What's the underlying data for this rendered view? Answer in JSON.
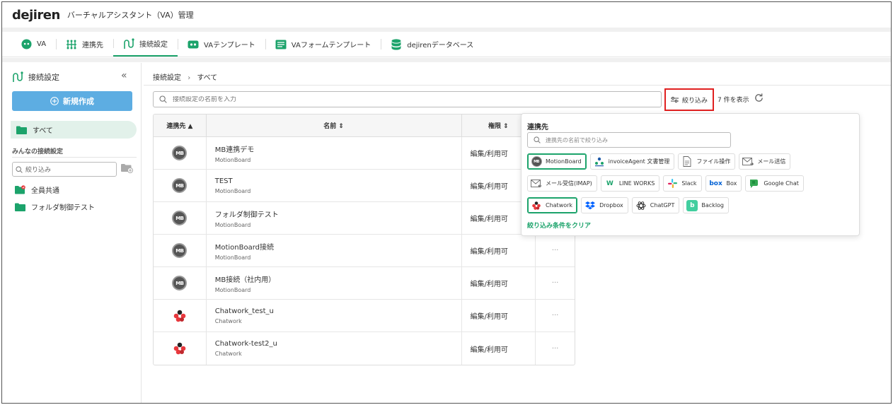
{
  "header": {
    "logo": "dejiren",
    "title": "バーチャルアシスタント（VA）管理"
  },
  "tabs": [
    {
      "label": "VA",
      "icon": "va-robot-icon"
    },
    {
      "label": "連携先",
      "icon": "network-icon"
    },
    {
      "label": "接続設定",
      "icon": "connection-icon"
    },
    {
      "label": "VAテンプレート",
      "icon": "template-icon"
    },
    {
      "label": "VAフォームテンプレート",
      "icon": "form-icon"
    },
    {
      "label": "dejirenデータベース",
      "icon": "database-icon"
    }
  ],
  "sidebar": {
    "heading": "接続設定",
    "collapse": "«",
    "new_button": "新規作成",
    "all_label": "すべて",
    "section_title": "みんなの接続設定",
    "filter_placeholder": "絞り込み",
    "items": [
      {
        "label": "全員共通"
      },
      {
        "label": "フォルダ制御テスト"
      }
    ]
  },
  "main": {
    "breadcrumb": [
      "接続設定",
      "›",
      "すべて"
    ],
    "search_placeholder": "接続設定の名前を入力",
    "filter_button": "絞り込み",
    "count_text": "7 件を表示",
    "table": {
      "headers": [
        "連携先 ▲",
        "名前 ⇕",
        "権限 ⇕"
      ],
      "rows": [
        {
          "service": "MotionBoard",
          "name": "MB連携デモ",
          "sub": "MotionBoard",
          "perm": "編集/利用可",
          "more": "···"
        },
        {
          "service": "MotionBoard",
          "name": "TEST",
          "sub": "MotionBoard",
          "perm": "編集/利用可",
          "more": "···"
        },
        {
          "service": "MotionBoard",
          "name": "フォルダ制御テスト",
          "sub": "MotionBoard",
          "perm": "編集/利用可",
          "more": "···"
        },
        {
          "service": "MotionBoard",
          "name": "MotionBoard接続",
          "sub": "MotionBoard",
          "perm": "編集/利用可",
          "more": "···"
        },
        {
          "service": "MotionBoard",
          "name": "MB接続（社内用）",
          "sub": "MotionBoard",
          "perm": "編集/利用可",
          "more": "···"
        },
        {
          "service": "Chatwork",
          "name": "Chatwork_test_u",
          "sub": "Chatwork",
          "perm": "編集/利用可",
          "more": "···"
        },
        {
          "service": "Chatwork",
          "name": "Chatwork-test2_u",
          "sub": "Chatwork",
          "perm": "編集/利用可",
          "more": "···"
        }
      ]
    }
  },
  "filter_panel": {
    "title": "連携先",
    "search_placeholder": "連携先の名前で絞り込み",
    "chips": [
      {
        "label": "MotionBoard",
        "selected": true
      },
      {
        "label": "invoiceAgent 文書管理",
        "selected": false
      },
      {
        "label": "ファイル操作",
        "selected": false
      },
      {
        "label": "メール送信",
        "selected": false
      },
      {
        "label": "メール受信(IMAP)",
        "selected": false
      },
      {
        "label": "LINE WORKS",
        "selected": false
      },
      {
        "label": "Slack",
        "selected": false
      },
      {
        "label": "Box",
        "selected": false
      },
      {
        "label": "Google Chat",
        "selected": false
      },
      {
        "label": "Chatwork",
        "selected": true
      },
      {
        "label": "Dropbox",
        "selected": false
      },
      {
        "label": "ChatGPT",
        "selected": false
      },
      {
        "label": "Backlog",
        "selected": false
      }
    ],
    "clear_label": "絞り込み条件をクリア"
  },
  "icon_text": {
    "mb": "MB",
    "box": "box",
    "line": "W",
    "backlog": "b"
  },
  "colors": {
    "accent": "#1ca36b",
    "new_button": "#5dade2",
    "highlight_border": "#e02020",
    "chatwork_red": "#e8383d"
  }
}
